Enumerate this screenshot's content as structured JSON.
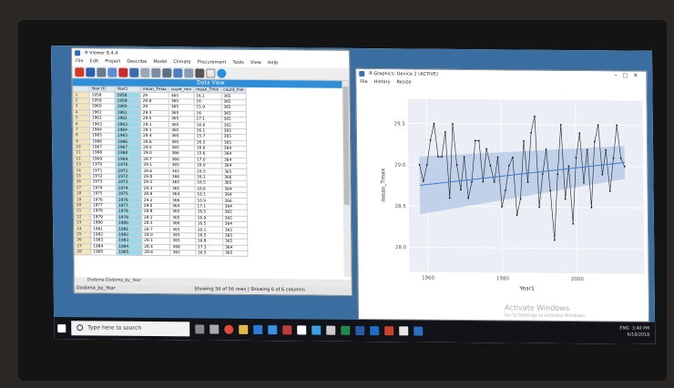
{
  "rviewer": {
    "title": "R Viewer 8.4.4",
    "menu": [
      "File",
      "Edit",
      "Project",
      "Describe",
      "Model",
      "Climate",
      "Procurement",
      "Tools",
      "View",
      "Help"
    ],
    "data_view_title": "Data View",
    "columns": [
      "Year (t)",
      "Year1",
      "mean_Tmax",
      "count_min",
      "mean_Tmin",
      "count_min"
    ],
    "rows": [
      [
        "1",
        "1958",
        "1958",
        "29",
        "365",
        "16.1",
        "365"
      ],
      [
        "2",
        "1959",
        "1959",
        "28.8",
        "365",
        "16",
        "365"
      ],
      [
        "3",
        "1960",
        "1960",
        "29",
        "365",
        "15.9",
        "365"
      ],
      [
        "4",
        "1961",
        "1961",
        "29.3",
        "365",
        "16",
        "365"
      ],
      [
        "5",
        "1962",
        "1962",
        "29.5",
        "365",
        "17.1",
        "365"
      ],
      [
        "6",
        "1963",
        "1963",
        "29.1",
        "365",
        "16.6",
        "365"
      ],
      [
        "7",
        "1964",
        "1964",
        "29.1",
        "365",
        "16.1",
        "365"
      ],
      [
        "8",
        "1965",
        "1965",
        "29.4",
        "365",
        "15.7",
        "365"
      ],
      [
        "9",
        "1966",
        "1966",
        "28.6",
        "365",
        "16.5",
        "365"
      ],
      [
        "10",
        "1967",
        "1967",
        "29.5",
        "365",
        "16.6",
        "364"
      ],
      [
        "11",
        "1968",
        "1968",
        "29.0",
        "366",
        "15.6",
        "364"
      ],
      [
        "12",
        "1969",
        "1969",
        "28.7",
        "366",
        "17.0",
        "364"
      ],
      [
        "13",
        "1970",
        "1970",
        "29.1",
        "365",
        "16.0",
        "364"
      ],
      [
        "14",
        "1971",
        "1971",
        "28.6",
        "365",
        "16.5",
        "365"
      ],
      [
        "15",
        "1972",
        "1972",
        "28.8",
        "366",
        "16.1",
        "366"
      ],
      [
        "16",
        "1973",
        "1973",
        "29.3",
        "365",
        "16.5",
        "365"
      ],
      [
        "17",
        "1974",
        "1974",
        "29.3",
        "365",
        "16.6",
        "364"
      ],
      [
        "18",
        "1975",
        "1975",
        "28.8",
        "364",
        "16.1",
        "364"
      ],
      [
        "19",
        "1976",
        "1976",
        "29.2",
        "366",
        "16.9",
        "366"
      ],
      [
        "20",
        "1977",
        "1977",
        "29.0",
        "364",
        "17.1",
        "364"
      ],
      [
        "21",
        "1978",
        "1978",
        "28.8",
        "365",
        "16.5",
        "365"
      ],
      [
        "22",
        "1979",
        "1979",
        "29.1",
        "365",
        "16.9",
        "365"
      ],
      [
        "23",
        "1980",
        "1980",
        "28.5",
        "366",
        "16.5",
        "364"
      ],
      [
        "24",
        "1981",
        "1981",
        "28.7",
        "365",
        "16.1",
        "365"
      ],
      [
        "25",
        "1982",
        "1982",
        "29.0",
        "365",
        "16.5",
        "365"
      ],
      [
        "26",
        "1983",
        "1983",
        "29.1",
        "365",
        "16.8",
        "365"
      ],
      [
        "27",
        "1984",
        "1984",
        "28.4",
        "366",
        "17.3",
        "364"
      ],
      [
        "28",
        "1985",
        "1985",
        "28.6",
        "365",
        "16.5",
        "365"
      ]
    ],
    "tabs": "Dodoma   Dodoma_by_Year",
    "status": "Showing 56 of 56 rows | Showing 6 of 6 columns",
    "left_status": "Dodoma_by_Year"
  },
  "graphics": {
    "title": "R Graphics: Device 2 (ACTIVE)",
    "menu": [
      "File",
      "History",
      "Resize"
    ],
    "ylabel": "mean_Tmax",
    "xlabel": "Year1",
    "watermark": "Activate Windows",
    "watermark_sub": "Go to Settings to activate Windows."
  },
  "chart_data": {
    "type": "line",
    "xlabel": "Year1",
    "ylabel": "mean_Tmax",
    "xlim": [
      1955,
      2018
    ],
    "ylim": [
      27.7,
      29.8
    ],
    "x_ticks": [
      "1960",
      "1980",
      "2000"
    ],
    "y_ticks": [
      "28.0",
      "28.5",
      "29.0",
      "29.5"
    ],
    "trend": {
      "start": 28.75,
      "end": 29.05,
      "band_start_lo": 28.4,
      "band_start_hi": 29.1,
      "band_end_lo": 28.85,
      "band_end_hi": 29.25
    },
    "x": [
      1958,
      1959,
      1960,
      1961,
      1962,
      1963,
      1964,
      1965,
      1966,
      1967,
      1968,
      1969,
      1970,
      1971,
      1972,
      1973,
      1974,
      1975,
      1976,
      1977,
      1978,
      1979,
      1980,
      1981,
      1982,
      1983,
      1984,
      1985,
      1986,
      1987,
      1988,
      1989,
      1990,
      1991,
      1992,
      1993,
      1994,
      1995,
      1996,
      1997,
      1998,
      1999,
      2000,
      2001,
      2002,
      2003,
      2004,
      2005,
      2006,
      2007,
      2008,
      2009,
      2010,
      2011,
      2012,
      2013
    ],
    "values": [
      29.0,
      28.8,
      29.0,
      29.3,
      29.5,
      29.1,
      29.1,
      29.4,
      28.6,
      29.5,
      29.0,
      28.7,
      29.1,
      28.6,
      28.8,
      29.3,
      29.3,
      28.8,
      29.2,
      29.0,
      28.8,
      29.1,
      28.5,
      28.7,
      29.0,
      29.1,
      28.4,
      28.6,
      29.3,
      28.8,
      29.4,
      29.6,
      28.5,
      28.9,
      29.2,
      28.7,
      28.1,
      28.9,
      29.5,
      28.6,
      29.0,
      28.3,
      29.1,
      29.4,
      28.8,
      29.2,
      28.5,
      29.3,
      29.5,
      28.9,
      29.2,
      28.7,
      29.1,
      29.5,
      29.1,
      29.0
    ]
  },
  "taskbar": {
    "search_placeholder": "Type here to search",
    "lang": "ENG",
    "time": "3:40 PM",
    "date": "6/18/2018"
  },
  "colors": {
    "accent": "#2e8fd8",
    "highlight_col": "#9ed8e6",
    "rownum": "#f3e6bd",
    "band": "#b9cbe6",
    "trend": "#3a7bd5"
  }
}
